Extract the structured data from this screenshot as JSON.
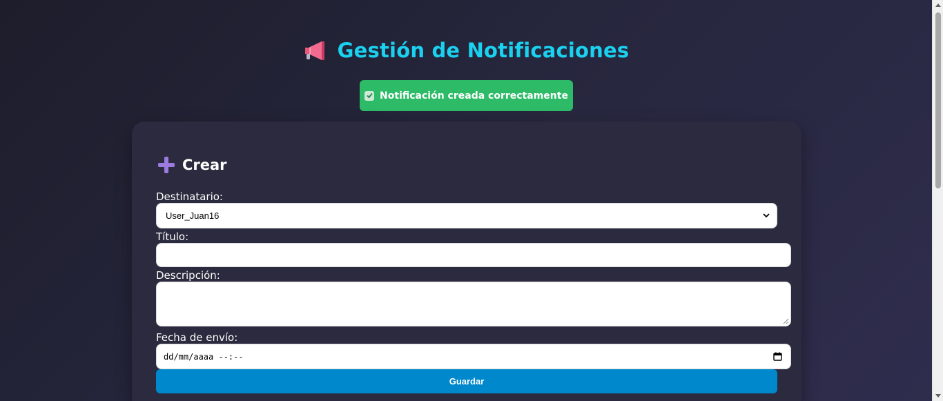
{
  "header": {
    "title": "Gestión de Notificaciones",
    "icon": "megaphone-icon"
  },
  "alert": {
    "message": "Notificación creada correctamente",
    "icon": "check-icon",
    "color": "#2dbb68"
  },
  "form": {
    "heading": "Crear",
    "heading_icon": "plus-icon",
    "recipient_label": "Destinatario:",
    "recipient_value": "User_Juan16",
    "title_label": "Título:",
    "title_value": "",
    "description_label": "Descripción:",
    "description_value": "",
    "date_label": "Fecha de envío:",
    "date_placeholder": "dd/mm/aaaa --:--",
    "save_label": "Guardar"
  },
  "colors": {
    "accent_title": "#1ad1f0",
    "button": "#0088cc",
    "card": "#2b2a3e"
  }
}
